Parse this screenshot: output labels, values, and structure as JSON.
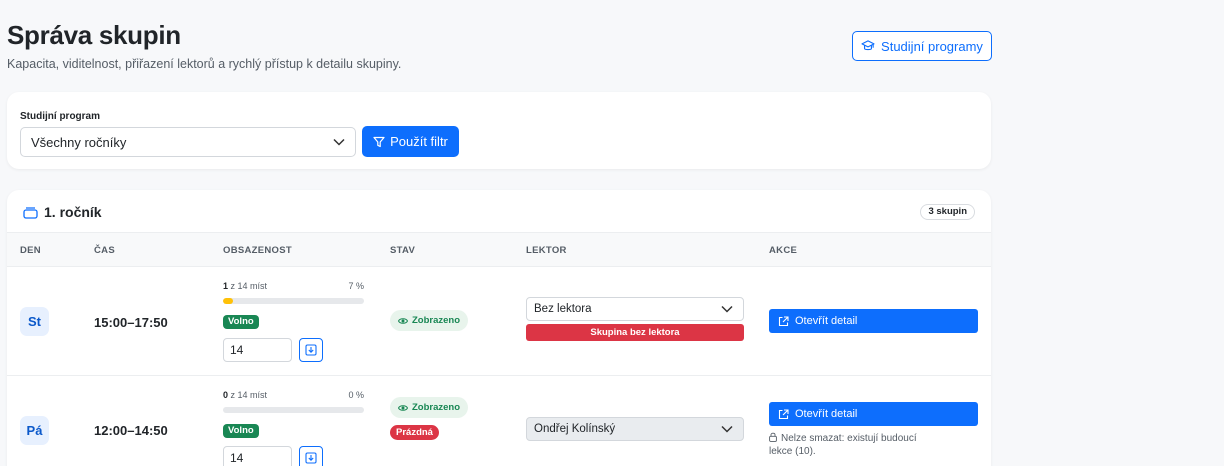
{
  "header": {
    "title": "Správa skupin",
    "subtitle": "Kapacita, viditelnost, přiřazení lektorů a rychlý přístup k detailu skupiny.",
    "programs_button": "Studijní programy"
  },
  "filter": {
    "label": "Studijní program",
    "selected": "Všechny ročníky",
    "apply_button": "Použít filtr"
  },
  "group": {
    "title": "1. ročník",
    "count_badge": "3 skupin",
    "columns": [
      "DEN",
      "ČAS",
      "OBSAZENOST",
      "STAV",
      "LEKTOR",
      "AKCE"
    ],
    "rows": [
      {
        "day": "St",
        "time": "15:00–17:50",
        "occupied": "1",
        "capacity_text": "z 14 míst",
        "percent_text": "7 %",
        "fill_fraction": 0.07,
        "availability": "Volno",
        "capacity_value": "14",
        "visibility": "Zobrazeno",
        "state_extra": "",
        "lector": "Bez lektora",
        "lector_warning": "Skupina bez lektora",
        "open_button": "Otevřít detail",
        "lock_note": ""
      },
      {
        "day": "Pá",
        "time": "12:00–14:50",
        "occupied": "0",
        "capacity_text": "z 14 míst",
        "percent_text": "0 %",
        "fill_fraction": 0,
        "availability": "Volno",
        "capacity_value": "14",
        "visibility": "Zobrazeno",
        "state_extra": "Prázdná",
        "lector": "Ondřej Kolínský",
        "lector_warning": "",
        "open_button": "Otevřít detail",
        "lock_note": "Nelze smazat: existují budoucí lekce (10)."
      }
    ]
  },
  "icons": {
    "programs": "graduation-cap-icon",
    "filter": "funnel-icon",
    "group": "stack-icon",
    "visible": "eye-icon",
    "save": "save-arrow-icon",
    "open": "external-link-icon",
    "lock": "lock-icon"
  },
  "colors": {
    "primary": "#0d6efd",
    "success": "#198754",
    "danger": "#dc3545",
    "warning": "#ffc107"
  }
}
